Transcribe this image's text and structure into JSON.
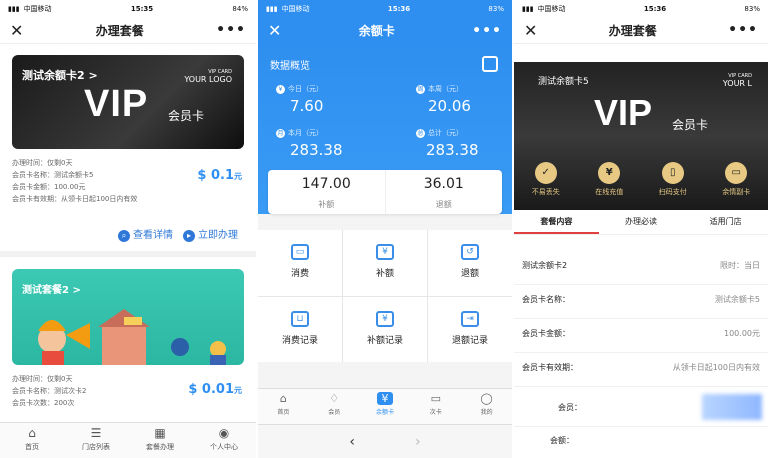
{
  "panel1": {
    "status": {
      "carrier": "中国移动",
      "time": "15:35",
      "battery": "84%"
    },
    "title": "办理套餐",
    "card1": {
      "name": "测试余额卡2 >",
      "logo_small": "VIP CARD",
      "logo": "YOUR LOGO",
      "big": "VIP",
      "sub": "会员卡"
    },
    "info1": [
      "办理时间：仅剩0天",
      "会员卡名称：测试余额卡5",
      "会员卡金额：100.00元",
      "会员卡有效期：从领卡日起100日内有效"
    ],
    "price1": "$ 0.1",
    "price1_unit": "元",
    "btn_detail": "查看详情",
    "btn_apply": "立即办理",
    "card2": {
      "name": "测试套餐2 >"
    },
    "info2": [
      "办理时间：仅剩0天",
      "会员卡名称：测试次卡2",
      "会员卡次数：200次"
    ],
    "price2": "$ 0.01",
    "price2_unit": "元",
    "tabs": [
      "首页",
      "门店列表",
      "套餐办理",
      "个人中心"
    ]
  },
  "panel2": {
    "status": {
      "carrier": "中国移动",
      "time": "15:36",
      "battery": "83%"
    },
    "title": "余额卡",
    "overview": "数据概览",
    "stats": [
      {
        "label": "今日（元）",
        "value": "7.60",
        "dot": "¥"
      },
      {
        "label": "本周（元）",
        "value": "20.06",
        "dot": "周"
      },
      {
        "label": "本月（元）",
        "value": "283.38",
        "dot": "月"
      },
      {
        "label": "总计（元）",
        "value": "283.38",
        "dot": "总"
      }
    ],
    "totals": [
      {
        "value": "147.00",
        "label": "补额"
      },
      {
        "value": "36.01",
        "label": "退额"
      }
    ],
    "grid": [
      "消费",
      "补额",
      "退额",
      "消费记录",
      "补额记录",
      "退额记录"
    ],
    "tabs": [
      "首页",
      "会员",
      "余额卡",
      "次卡",
      "我的"
    ],
    "active_tab": "余额卡"
  },
  "panel3": {
    "status": {
      "carrier": "中国移动",
      "time": "15:36",
      "battery": "83%"
    },
    "title": "办理套餐",
    "card": {
      "name": "测试余额卡5",
      "logo_small": "VIP CARD",
      "logo": "YOUR L",
      "big": "VIP",
      "sub": "会员卡"
    },
    "features": [
      "不易丢失",
      "在线充值",
      "扫码支付",
      "余情副卡"
    ],
    "tabs": [
      "套餐内容",
      "办理必读",
      "适用门店"
    ],
    "rows": [
      {
        "k": "测试余额卡2",
        "v": "限时：当日"
      },
      {
        "k": "会员卡名称：",
        "v": "测试余额卡5"
      },
      {
        "k": "会员卡金额：",
        "v": "100.00元"
      },
      {
        "k": "会员卡有效期：",
        "v": "从领卡日起100日内有效"
      },
      {
        "k": "会员：",
        "v": ""
      },
      {
        "k": "会额：",
        "v": ""
      }
    ]
  }
}
